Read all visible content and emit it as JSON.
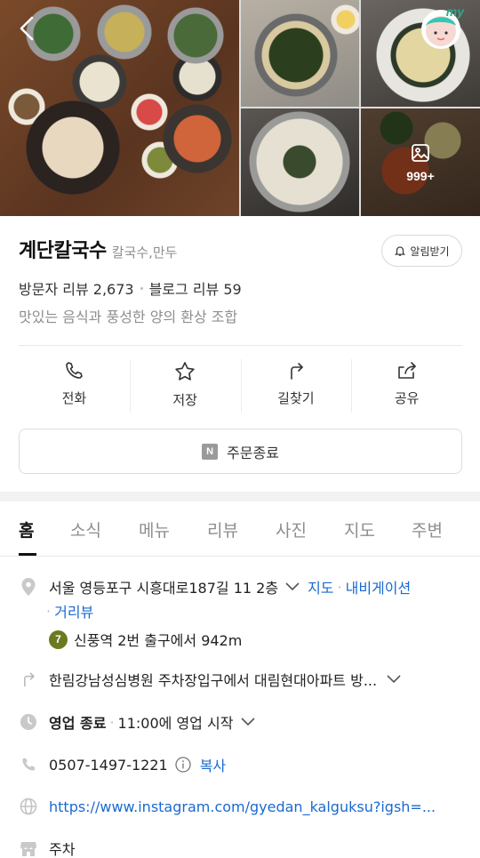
{
  "photos": {
    "more_count": "999+"
  },
  "my_button": {
    "label": "my"
  },
  "header": {
    "name": "계단칼국수",
    "category": "칼국수,만두",
    "alarm_label": "알림받기",
    "visitor_reviews": "방문자 리뷰 2,673",
    "blog_reviews": "블로그 리뷰 59",
    "description": "맛있는 음식과 풍성한 양의 환상 조합"
  },
  "actions": [
    {
      "label": "전화",
      "icon": "phone-icon"
    },
    {
      "label": "저장",
      "icon": "star-icon"
    },
    {
      "label": "길찾기",
      "icon": "directions-icon"
    },
    {
      "label": "공유",
      "icon": "share-icon"
    }
  ],
  "order": {
    "badge": "N",
    "label": "주문종료"
  },
  "tabs": [
    "홈",
    "소식",
    "메뉴",
    "리뷰",
    "사진",
    "지도",
    "주변"
  ],
  "active_tab": "홈",
  "info": {
    "address": "서울 영등포구 시흥대로187길 11 2층",
    "map_link": "지도",
    "navigation_link": "내비게이션",
    "distance_link": "거리뷰",
    "subway_line": "7",
    "subway_text": "신풍역 2번 출구에서 942m",
    "directions": "한림강남성심병원 주차장입구에서 대림현대아파트 방...",
    "hours_status": "영업 종료",
    "hours_detail": "11:00에 영업 시작",
    "phone": "0507-1497-1221",
    "copy_label": "복사",
    "website": "https://www.instagram.com/gyedan_kalguksu?igsh=...",
    "parking": "주차"
  },
  "colors": {
    "link": "#1a6ad1",
    "subway_line_7": "#6b7a1f"
  }
}
